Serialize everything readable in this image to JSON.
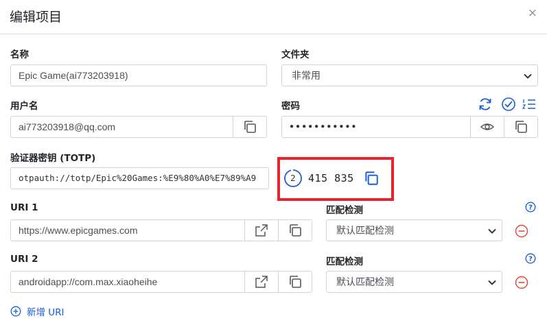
{
  "dialog": {
    "title": "编辑项目",
    "close_glyph": "×"
  },
  "name": {
    "label": "名称",
    "value": "Epic Game(ai773203918)"
  },
  "folder": {
    "label": "文件夹",
    "value": "非常用"
  },
  "username": {
    "label": "用户名",
    "value": "ai773203918@qq.com"
  },
  "password": {
    "label": "密码",
    "value": "●●●●●●●●●●●"
  },
  "totp": {
    "label": "验证器密钥 (TOTP)",
    "value": "otpauth://totp/Epic%20Games:%E9%80%A0%E7%89%A9",
    "timer": "2",
    "code": "415 835"
  },
  "uris": [
    {
      "label": "URI 1",
      "value": "https://www.epicgames.com",
      "match_label": "匹配检测",
      "match_value": "默认匹配检测"
    },
    {
      "label": "URI 2",
      "value": "androidapp://com.max.xiaoheihe",
      "match_label": "匹配检测",
      "match_value": "默认匹配检测"
    }
  ],
  "add_uri_label": "新增 URI",
  "colors": {
    "accent": "#175ddc",
    "danger": "#dd4b39",
    "highlight": "#e8242a",
    "border": "#ced4da"
  }
}
